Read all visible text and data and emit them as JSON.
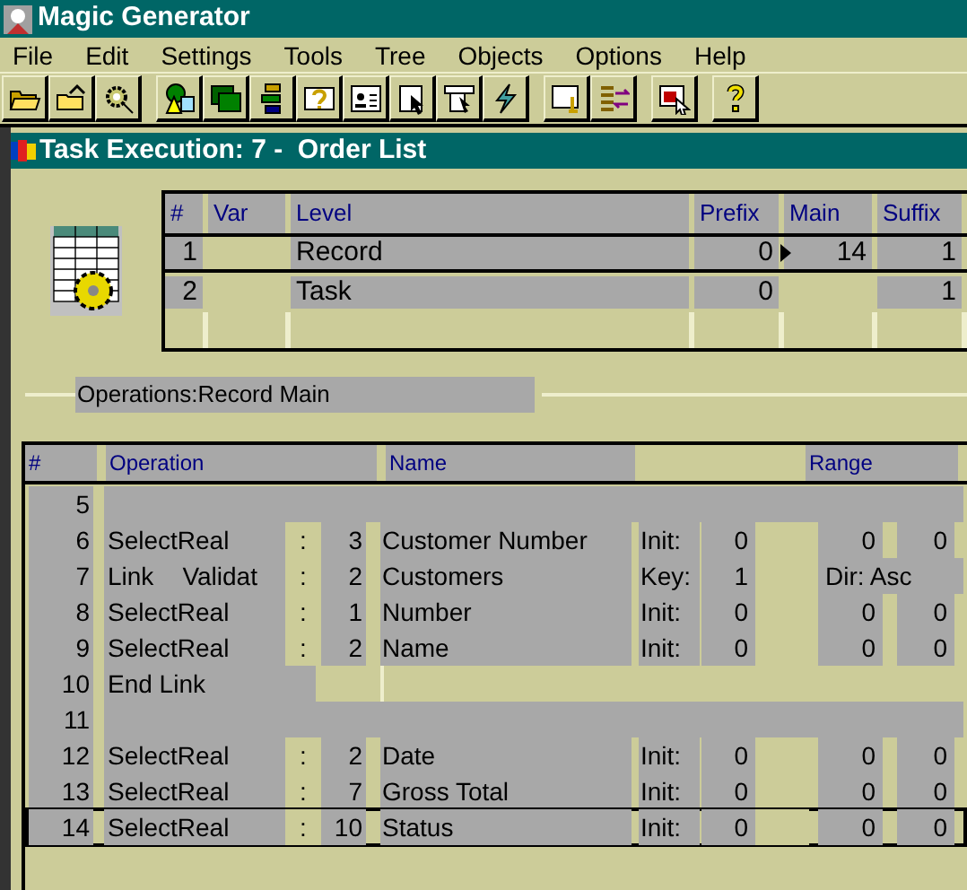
{
  "window": {
    "title": "Magic Generator"
  },
  "menu": [
    "File",
    "Edit",
    "Settings",
    "Tools",
    "Tree",
    "Objects",
    "Options",
    "Help"
  ],
  "task_window": {
    "title": "Task Execution: 7 -  Order List"
  },
  "levels_table": {
    "columns": [
      "#",
      "Var",
      "Level",
      "Prefix",
      "Main",
      "Suffix"
    ],
    "rows": [
      {
        "num": "1",
        "level": "Record",
        "prefix": "0",
        "main": "14",
        "suffix": "1",
        "selected": true
      },
      {
        "num": "2",
        "level": "Task",
        "prefix": "0",
        "suffix": "1",
        "selected": false
      }
    ]
  },
  "operations_label": "Operations:Record Main",
  "operations_table": {
    "columns": [
      "#",
      "Operation",
      "Name",
      "Range"
    ],
    "rows": [
      {
        "kind": "empty",
        "num": "5",
        "selected": false
      },
      {
        "kind": "select",
        "num": "6",
        "operation": "SelectReal",
        "sep": ":",
        "count": "3",
        "name": "Customer Number",
        "init_label": "Init:",
        "init_value": "0",
        "range_from": "0",
        "range_to": "0",
        "selected": false
      },
      {
        "kind": "link",
        "num": "7",
        "operation": "Link",
        "mode": "Validat",
        "sep": ":",
        "count": "2",
        "name": "Customers",
        "init_label": "Key:",
        "init_value": "1",
        "range_text": "Dir: Asc",
        "selected": false
      },
      {
        "kind": "select",
        "num": "8",
        "operation": "SelectReal",
        "sep": ":",
        "count": "1",
        "name": "Number",
        "init_label": "Init:",
        "init_value": "0",
        "range_from": "0",
        "range_to": "0",
        "selected": false
      },
      {
        "kind": "select",
        "num": "9",
        "operation": "SelectReal",
        "sep": ":",
        "count": "2",
        "name": "Name",
        "init_label": "Init:",
        "init_value": "0",
        "range_from": "0",
        "range_to": "0",
        "selected": false
      },
      {
        "kind": "end",
        "num": "10",
        "operation": "End Link",
        "selected": false
      },
      {
        "kind": "empty",
        "num": "11",
        "selected": false
      },
      {
        "kind": "select",
        "num": "12",
        "operation": "SelectReal",
        "sep": ":",
        "count": "2",
        "name": "Date",
        "init_label": "Init:",
        "init_value": "0",
        "range_from": "0",
        "range_to": "0",
        "selected": false
      },
      {
        "kind": "select",
        "num": "13",
        "operation": "SelectReal",
        "sep": ":",
        "count": "7",
        "name": "Gross Total",
        "init_label": "Init:",
        "init_value": "0",
        "range_from": "0",
        "range_to": "0",
        "selected": false
      },
      {
        "kind": "select",
        "num": "14",
        "operation": "SelectReal",
        "sep": ":",
        "count": "10",
        "name": "Status",
        "init_label": "Init:",
        "init_value": "0",
        "range_from": "0",
        "range_to": "0",
        "selected": true
      }
    ]
  }
}
